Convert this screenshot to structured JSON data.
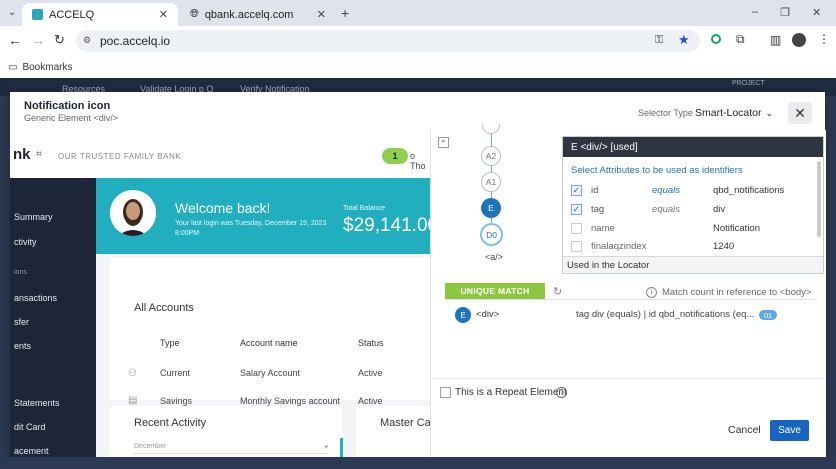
{
  "browser": {
    "tabs": [
      {
        "title": "ACCELQ",
        "active": true
      },
      {
        "title": "qbank.accelq.com",
        "active": false
      }
    ],
    "new_tab_symbol": "+",
    "url": "poc.accelq.io",
    "bookmarks_label": "Bookmarks",
    "window_controls": [
      "–",
      "❐",
      "✕"
    ]
  },
  "app_behind": {
    "tabs": [
      "Resources",
      "Validate Login p O",
      "Verify Notification"
    ],
    "right_label": "PROJECT"
  },
  "modal": {
    "title": "Notification icon",
    "subtitle": "Generic Element <div/>",
    "selector_type_label": "Selector Type",
    "selector_type_value": "Smart-Locator",
    "close_symbol": "✕"
  },
  "preview": {
    "bank_title": "nk",
    "tagline": "OUR TRUSTED FAMILY BANK",
    "notification_count": "1",
    "greeting_suffix": "o Tho",
    "sidebar": [
      "Summary",
      "ctivity",
      "ions",
      "ansactions",
      "sfer",
      "ents",
      "Statements",
      "dit Card",
      "acement"
    ],
    "welcome_title": "Welcome back!",
    "welcome_sub": "Your last login was Tuesday, December 19, 2023 8:00PM",
    "balance_label": "Total Balance",
    "balance_value": "$29,141.00",
    "accounts_title": "All Accounts",
    "accounts_headers": [
      "Type",
      "Account name",
      "Status"
    ],
    "accounts_rows": [
      [
        "Current",
        "Salary Account",
        "Active"
      ],
      [
        "Savings",
        "Monthly Savings account",
        "Active"
      ]
    ],
    "recent_activity": "Recent Activity",
    "recent_filter": "December",
    "master_card": "Master Ca"
  },
  "tree": {
    "nodes": [
      "A2",
      "A1",
      "E",
      "D0"
    ],
    "bottom_label": "<a/>"
  },
  "attributes": {
    "header": "E  <div/> [used]",
    "caption": "Select Attributes to be used as identifiers",
    "rows": [
      {
        "name": "id",
        "op": "equals",
        "value": "qbd_notifications",
        "checked": true
      },
      {
        "name": "tag",
        "op": "equals",
        "value": "div",
        "checked": true
      },
      {
        "name": "name",
        "op": "",
        "value": "Notification",
        "checked": false
      },
      {
        "name": "finalaqzindex",
        "op": "",
        "value": "1240",
        "checked": false
      }
    ],
    "footer": "Used in the Locator"
  },
  "match": {
    "tab_label": "UNIQUE  MATCH",
    "count_reference": "Match count in reference to  <body>",
    "row_node": "E",
    "row_tag": "<div>",
    "row_selector": "tag div (equals)  |  id qbd_notifications (eq...",
    "row_count": "01"
  },
  "repeat_label": "This is a Repeat Element",
  "buttons": {
    "cancel": "Cancel",
    "save": "Save"
  },
  "colors": {
    "accent": "#1565c0",
    "match_green": "#8dc63f",
    "banner": "#21afc0",
    "sidebar": "#1d2638"
  }
}
